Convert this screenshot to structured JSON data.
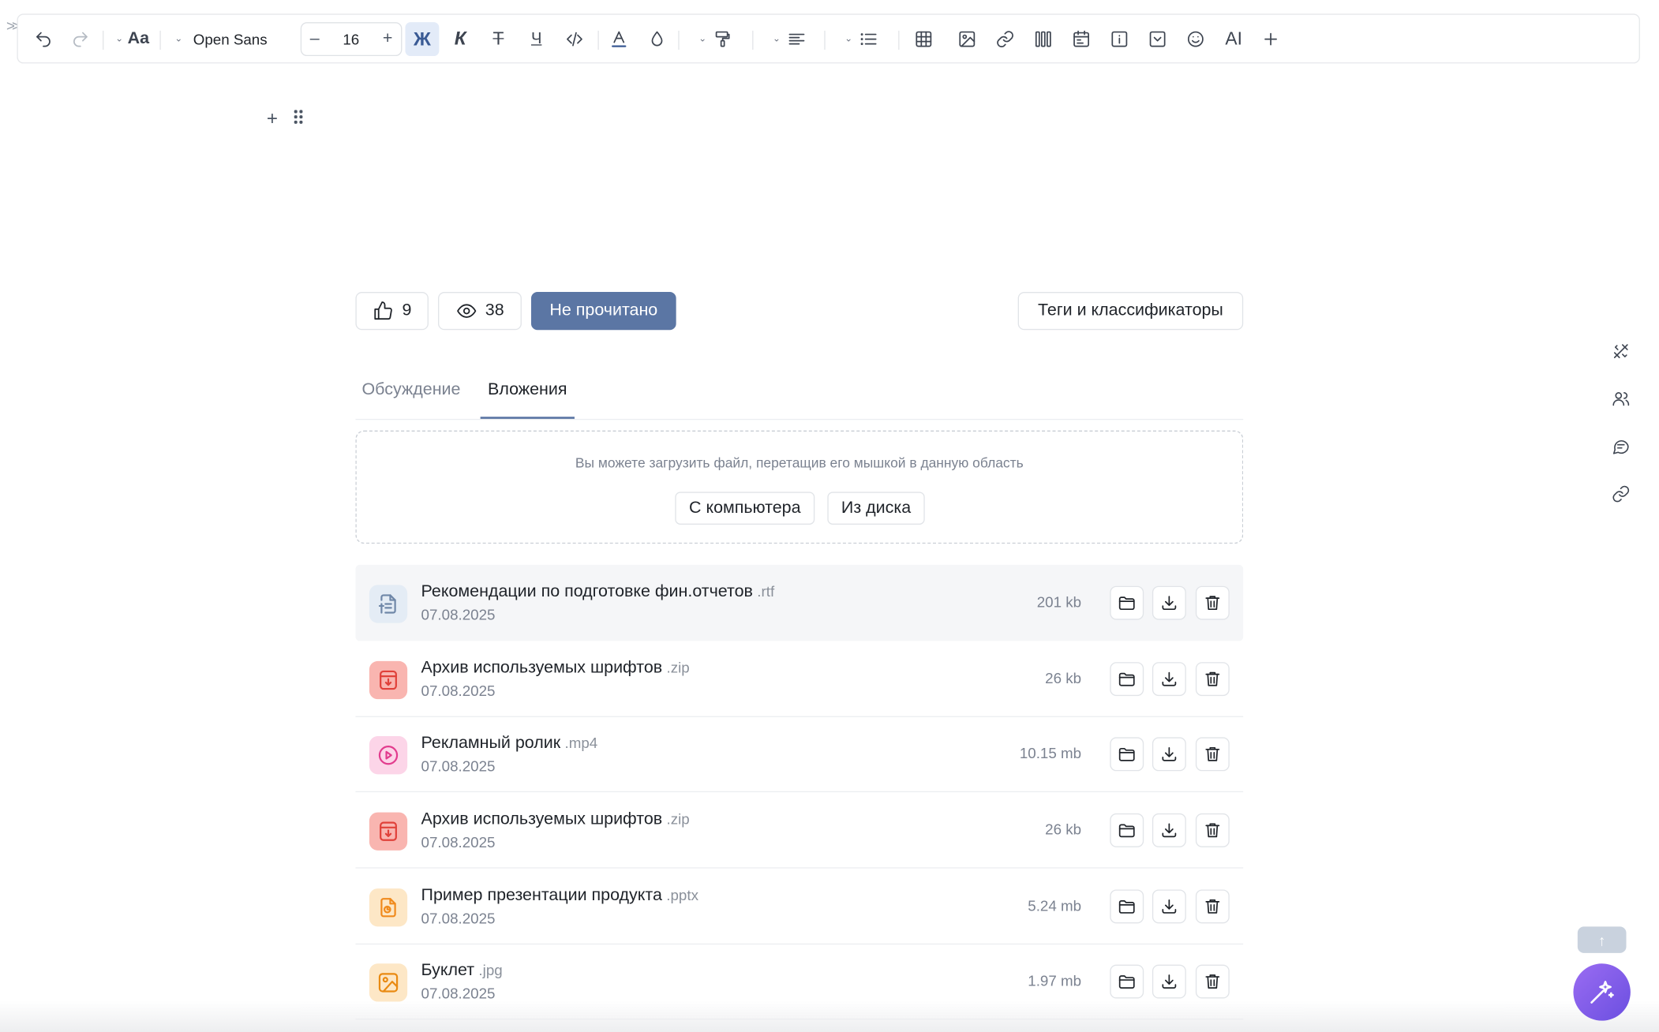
{
  "toolbar": {
    "font_family": "Open Sans",
    "font_size": "16",
    "minus": "–",
    "plus": "+",
    "bold": "Ж",
    "italic": "К",
    "strike": "Т",
    "underline": "Ч",
    "ai": "AI",
    "text_style": "Aa"
  },
  "actions": {
    "likes": "9",
    "views": "38",
    "unread_label": "Не прочитано",
    "tags_label": "Теги и классификаторы"
  },
  "tabs": [
    {
      "label": "Обсуждение",
      "active": false
    },
    {
      "label": "Вложения",
      "active": true
    }
  ],
  "dropzone": {
    "hint": "Вы можете загрузить файл, перетащив его мышкой в данную область",
    "from_computer": "С компьютера",
    "from_disk": "Из диска"
  },
  "files": [
    {
      "name": "Рекомендации по подготовке фин.отчетов",
      "ext": ".rtf",
      "date": "07.08.2025",
      "size": "201 kb",
      "icon": "document-icon",
      "color": "#6f87a8",
      "bg": "#e4ecf5"
    },
    {
      "name": "Архив используемых шрифтов",
      "ext": ".zip",
      "date": "07.08.2025",
      "size": "26 kb",
      "icon": "archive-icon",
      "color": "#e0413a",
      "bg": "#f9b5b0"
    },
    {
      "name": "Рекламный ролик",
      "ext": ".mp4",
      "date": "07.08.2025",
      "size": "10.15 mb",
      "icon": "video-icon",
      "color": "#e23c8e",
      "bg": "#fcd5e8"
    },
    {
      "name": "Архив используемых шрифтов",
      "ext": ".zip",
      "date": "07.08.2025",
      "size": "26 kb",
      "icon": "archive-icon",
      "color": "#e0413a",
      "bg": "#f9b5b0"
    },
    {
      "name": "Пример презентации продукта",
      "ext": ".pptx",
      "date": "07.08.2025",
      "size": "5.24 mb",
      "icon": "presentation-icon",
      "color": "#f08a1c",
      "bg": "#fde7c6"
    },
    {
      "name": "Буклет",
      "ext": ".jpg",
      "date": "07.08.2025",
      "size": "1.97 mb",
      "icon": "image-icon",
      "color": "#e98a12",
      "bg": "#fde7c6"
    }
  ],
  "colors": {
    "accent": "#5b76a4",
    "ai_button": "#8a5cf0"
  },
  "scroll_top_arrow": "↑"
}
